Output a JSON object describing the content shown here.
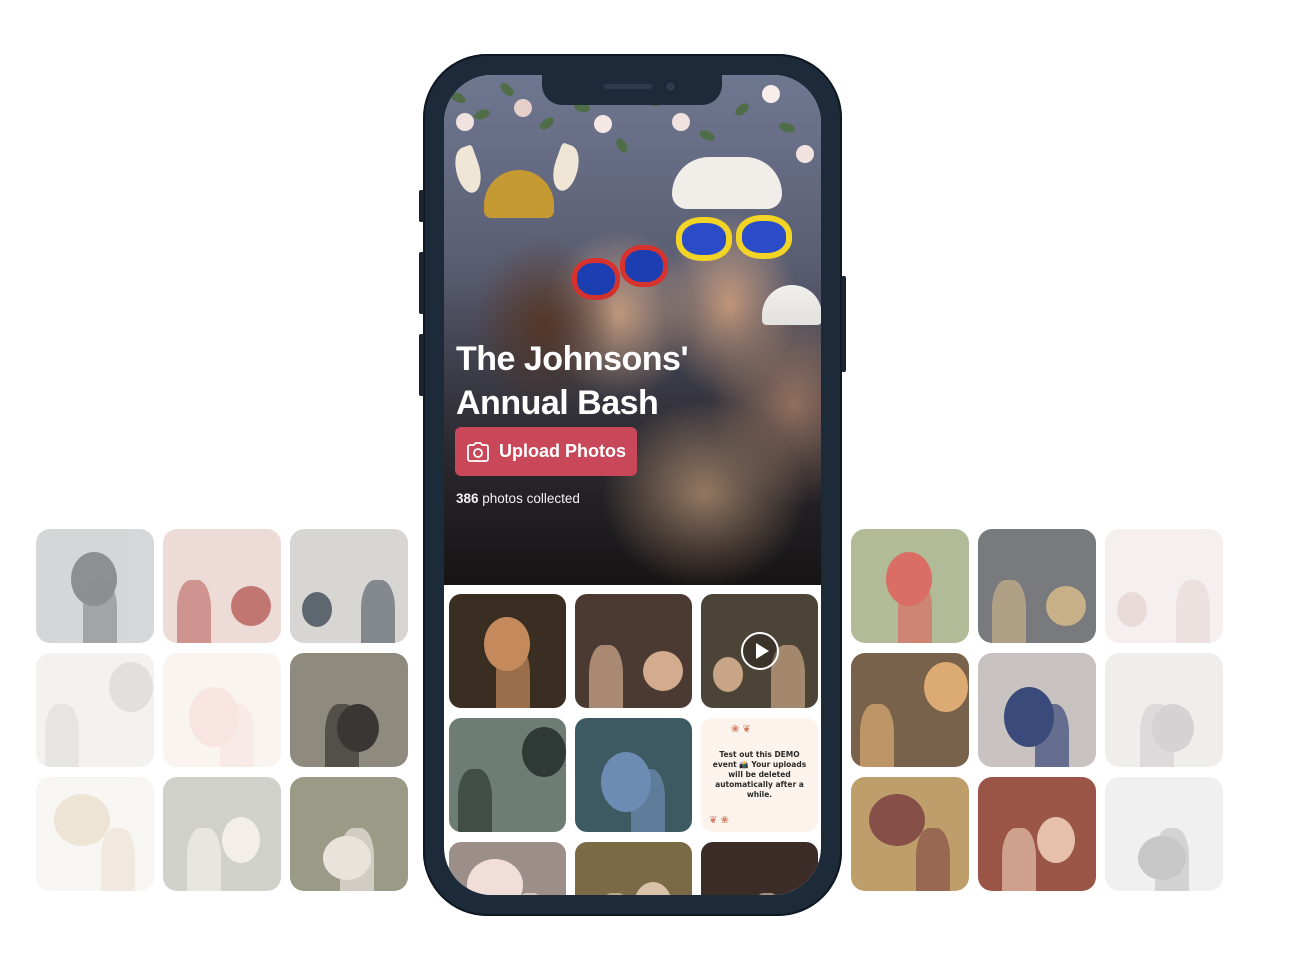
{
  "event": {
    "title_line1": "The Johnsons'",
    "title_line2": "Annual Bash",
    "upload_label": "Upload Photos",
    "photo_count": "386",
    "photo_count_suffix": " photos collected"
  },
  "demo_notice": "Test out this DEMO event 📸 Your uploads will be deleted automatically after a while.",
  "icons": {
    "upload": "camera-icon",
    "video": "play-icon"
  },
  "colors": {
    "upload_button": "#c8485a",
    "phone_frame": "#1d2a39",
    "demo_card": "#fbf3ec"
  },
  "side_photos_left": [
    {
      "bg": "#c9cccd",
      "accent": "#6d7172"
    },
    {
      "bg": "#e9d3cf",
      "accent": "#b4544f"
    },
    {
      "bg": "#d8d6d2",
      "accent": "#5e6770"
    },
    {
      "bg": "#e4e2de",
      "accent": "#b9b6b0"
    },
    {
      "bg": "#f4e8e2",
      "accent": "#f0c7c0"
    },
    {
      "bg": "#8e8a7e",
      "accent": "#3a3633"
    },
    {
      "bg": "#e8e2d8",
      "accent": "#c9a77a"
    },
    {
      "bg": "#c9c9c4",
      "accent": "#f1ece6"
    },
    {
      "bg": "#9a9a86",
      "accent": "#e9e3dc"
    }
  ],
  "side_photos_right": [
    {
      "bg": "#a9b48c",
      "accent": "#d75f54"
    },
    {
      "bg": "#787a7e",
      "accent": "#c8b089"
    },
    {
      "bg": "#e6dad6",
      "accent": "#c5a39a"
    },
    {
      "bg": "#6b5238",
      "accent": "#d9a264"
    },
    {
      "bg": "#c8c2c0",
      "accent": "#3a4a7a"
    },
    {
      "bg": "#d8d4d2",
      "accent": "#8f8a8a"
    },
    {
      "bg": "#b8955c",
      "accent": "#7a3e36"
    },
    {
      "bg": "#9a5546",
      "accent": "#e7c0ad"
    },
    {
      "bg": "#d8d8d8",
      "accent": "#6e6e6e"
    }
  ],
  "feed_photos": [
    {
      "bg": "#3a2d22",
      "accent": "#c48a5c",
      "video": false
    },
    {
      "bg": "#4a3a32",
      "accent": "#d3ab8e",
      "video": false
    },
    {
      "bg": "#4d4438",
      "accent": "#c8a586",
      "video": true
    },
    {
      "bg": "#6d7c74",
      "accent": "#2f3a36",
      "video": false
    },
    {
      "bg": "#3d5a62",
      "accent": "#6d8cb3",
      "video": false
    },
    {
      "demo": true
    },
    {
      "bg": "#9c8e88",
      "accent": "#f2ded8",
      "video": false
    },
    {
      "bg": "#7a6a45",
      "accent": "#d9c2a8",
      "video": false
    },
    {
      "bg": "#3b2c28",
      "accent": "#d9b7a0",
      "video": false
    }
  ]
}
